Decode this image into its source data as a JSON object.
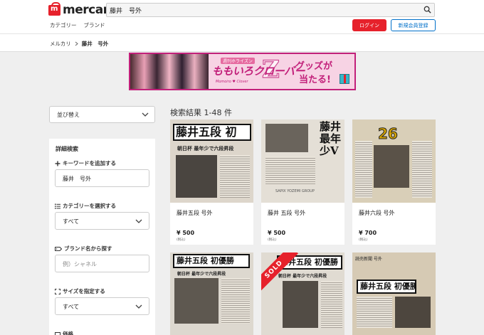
{
  "header": {
    "logo_text": "mercari",
    "search_value": "藤井　号外",
    "nav": [
      "カテゴリー",
      "ブランド"
    ],
    "login_label": "ログイン",
    "register_label": "新規会員登録"
  },
  "breadcrumb": [
    "メルカリ",
    "藤井　号外"
  ],
  "banner": {
    "sub": "週刊ホライズン",
    "title": "ももいろクローバー",
    "z": "Z",
    "brand": "Momoiro ♥ Clover",
    "goods": "グッズが",
    "hit": "当たる!"
  },
  "sort": {
    "label": "並び替え"
  },
  "filter": {
    "title": "詳細検索",
    "keyword_label": "キーワードを追加する",
    "keyword_value": "藤井　号外",
    "category_label": "カテゴリーを選択する",
    "category_value": "すべて",
    "brand_label": "ブランド名から探す",
    "brand_placeholder": "例）シャネル",
    "size_label": "サイズを指定する",
    "size_value": "すべて",
    "price_label": "価格"
  },
  "results": {
    "title": "検索結果 1-48 件",
    "items": [
      {
        "name": "藤井五段 号外",
        "price": "¥ 500",
        "tax": "(税込)",
        "headline": "藤井五段 初",
        "sub": "朝日杯 最年少で六段昇段"
      },
      {
        "name": "藤井 五段 号外",
        "price": "¥ 500",
        "tax": "(税込)",
        "headline": "藤井 最年少V",
        "sub": "SAPIX YOZEMI GROUP"
      },
      {
        "name": "藤井六段 号外",
        "price": "¥ 700",
        "tax": "(税込)",
        "headline": "26",
        "sub": ""
      },
      {
        "headline": "藤井五段 初優勝",
        "sub": "朝日杯 最年少で六段昇段"
      },
      {
        "headline": "藤井五段 初優勝",
        "sub": "朝日杯 最年少で六段昇段",
        "sold": "SOLD"
      },
      {
        "headline": "藤井五段 初優勝",
        "sub": "読売新聞 号外"
      }
    ]
  },
  "colors": {
    "brand_red": "#e6212b",
    "link_blue": "#0070c9"
  }
}
